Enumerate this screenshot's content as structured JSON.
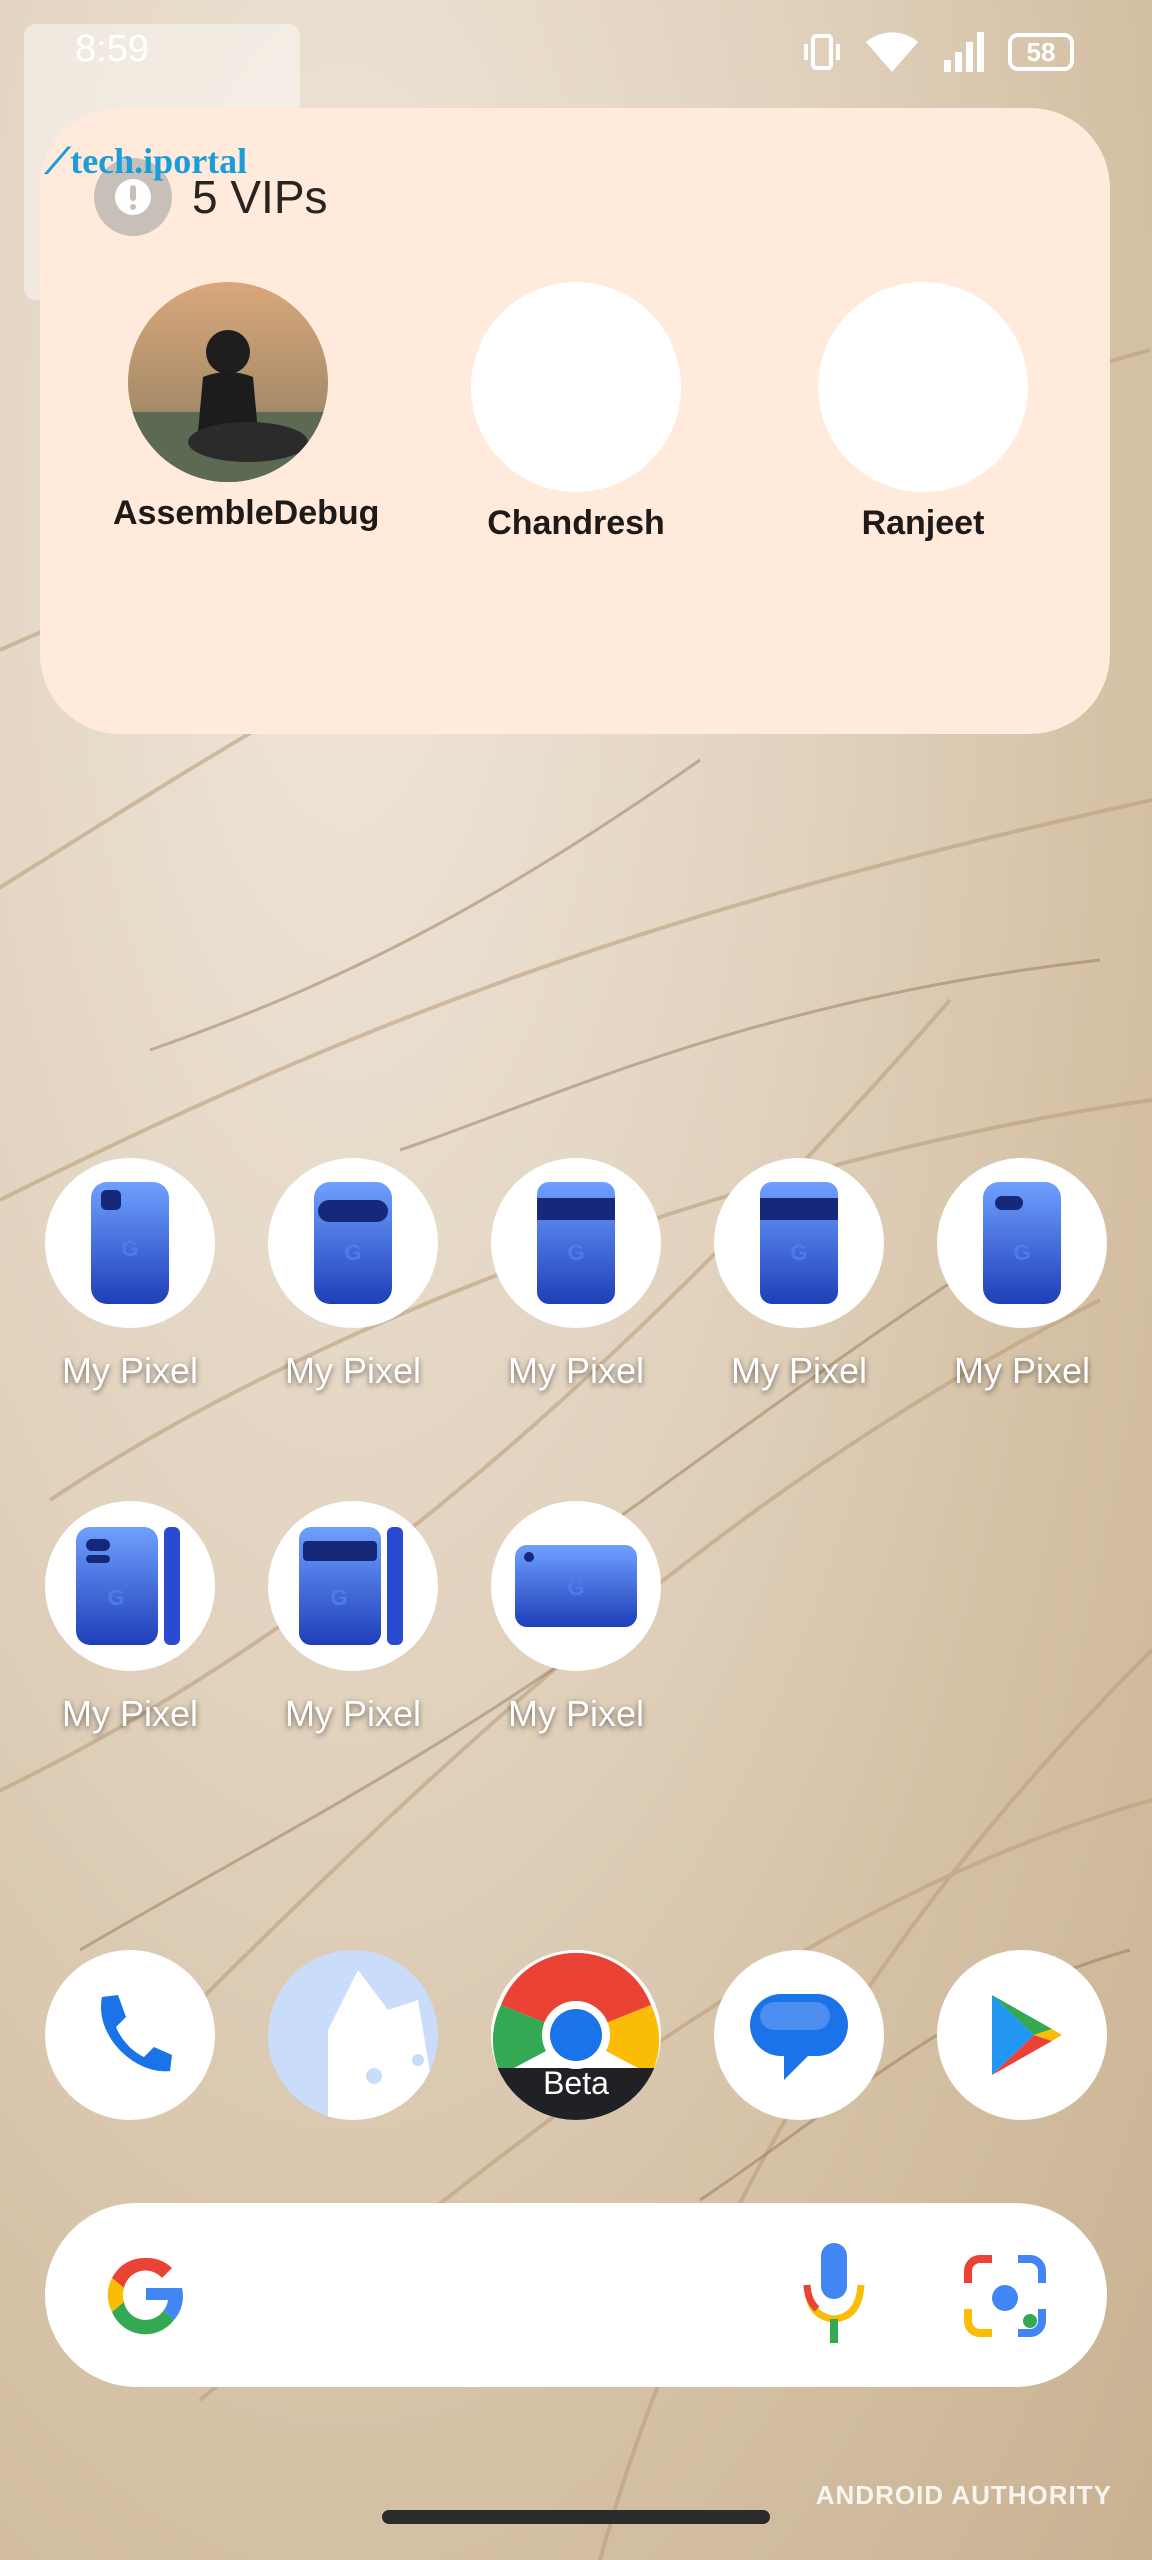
{
  "status": {
    "time": "8:59",
    "battery": "58"
  },
  "watermark": {
    "brand": "tech.iportal"
  },
  "vip_widget": {
    "title": "5 VIPs",
    "contacts": [
      {
        "name": "AssembleDebug"
      },
      {
        "name": "Chandresh"
      },
      {
        "name": "Ranjeet"
      }
    ]
  },
  "apps": [
    {
      "label": "My Pixel"
    },
    {
      "label": "My Pixel"
    },
    {
      "label": "My Pixel"
    },
    {
      "label": "My Pixel"
    },
    {
      "label": "My Pixel"
    },
    {
      "label": "My Pixel"
    },
    {
      "label": "My Pixel"
    },
    {
      "label": "My Pixel"
    }
  ],
  "dock": {
    "items": [
      {
        "icon": "phone-icon"
      },
      {
        "icon": "files-icon"
      },
      {
        "icon": "chrome-beta-icon",
        "badge": "Beta"
      },
      {
        "icon": "messages-icon"
      },
      {
        "icon": "play-store-icon"
      }
    ]
  },
  "search": {
    "logo": "google-g-icon"
  },
  "footer": {
    "watermark": "ANDROID AUTHORITY"
  },
  "colors": {
    "card": "#ffeadb",
    "pixel_blue": "#2f5fe0",
    "google_blue": "#4285f4",
    "google_red": "#ea4335",
    "google_yellow": "#fbbc05",
    "google_green": "#34a853"
  }
}
